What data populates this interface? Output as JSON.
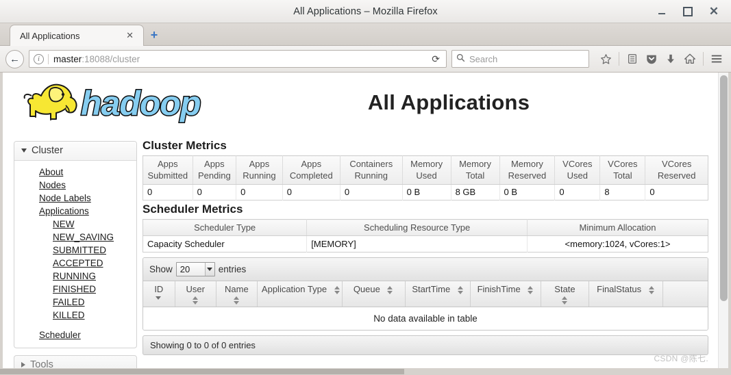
{
  "window": {
    "title": "All Applications – Mozilla Firefox",
    "minimize_label": "_",
    "maximize_label": "□",
    "close_label": "✕"
  },
  "tabs": {
    "items": [
      {
        "label": "All Applications",
        "close_label": "✕"
      }
    ],
    "new_tab_label": "+"
  },
  "navbar": {
    "back_label": "←",
    "info_label": "i",
    "url_host": "master",
    "url_rest": ":18088/cluster",
    "reload_label": "⟳",
    "search_placeholder": "Search",
    "search_value": "",
    "icons": [
      "star-icon",
      "library-icon",
      "pocket-icon",
      "downloads-icon",
      "home-icon",
      "menu-icon"
    ]
  },
  "masthead": {
    "logo_alt": "hadoop",
    "page_title": "All Applications"
  },
  "sidebar": {
    "cluster": {
      "header": "Cluster",
      "links": [
        "About",
        "Nodes",
        "Node Labels",
        "Applications"
      ],
      "app_states": [
        "NEW",
        "NEW_SAVING",
        "SUBMITTED",
        "ACCEPTED",
        "RUNNING",
        "FINISHED",
        "FAILED",
        "KILLED"
      ],
      "scheduler_link": "Scheduler"
    },
    "tools": {
      "header": "Tools"
    }
  },
  "cluster_metrics": {
    "title": "Cluster Metrics",
    "headers": [
      "Apps Submitted",
      "Apps Pending",
      "Apps Running",
      "Apps Completed",
      "Containers Running",
      "Memory Used",
      "Memory Total",
      "Memory Reserved",
      "VCores Used",
      "VCores Total",
      "VCores Reserved"
    ],
    "values": [
      "0",
      "0",
      "0",
      "0",
      "0",
      "0 B",
      "8 GB",
      "0 B",
      "0",
      "8",
      "0"
    ]
  },
  "scheduler_metrics": {
    "title": "Scheduler Metrics",
    "headers": [
      "Scheduler Type",
      "Scheduling Resource Type",
      "Minimum Allocation"
    ],
    "values": [
      "Capacity Scheduler",
      "[MEMORY]",
      "<memory:1024, vCores:1>"
    ]
  },
  "apps_table": {
    "show_label": "Show",
    "page_size": "20",
    "entries_label": "entries",
    "columns": [
      {
        "label": "ID",
        "sort": "desc"
      },
      {
        "label": "User",
        "sort": "both"
      },
      {
        "label": "Name",
        "sort": "both"
      },
      {
        "label": "Application Type",
        "sort": "both"
      },
      {
        "label": "Queue",
        "sort": "both"
      },
      {
        "label": "StartTime",
        "sort": "both"
      },
      {
        "label": "FinishTime",
        "sort": "both"
      },
      {
        "label": "State",
        "sort": "both"
      },
      {
        "label": "FinalStatus",
        "sort": "both"
      }
    ],
    "empty_message": "No data available in table",
    "footer_info": "Showing 0 to 0 of 0 entries"
  },
  "watermark": "CSDN @陈七."
}
